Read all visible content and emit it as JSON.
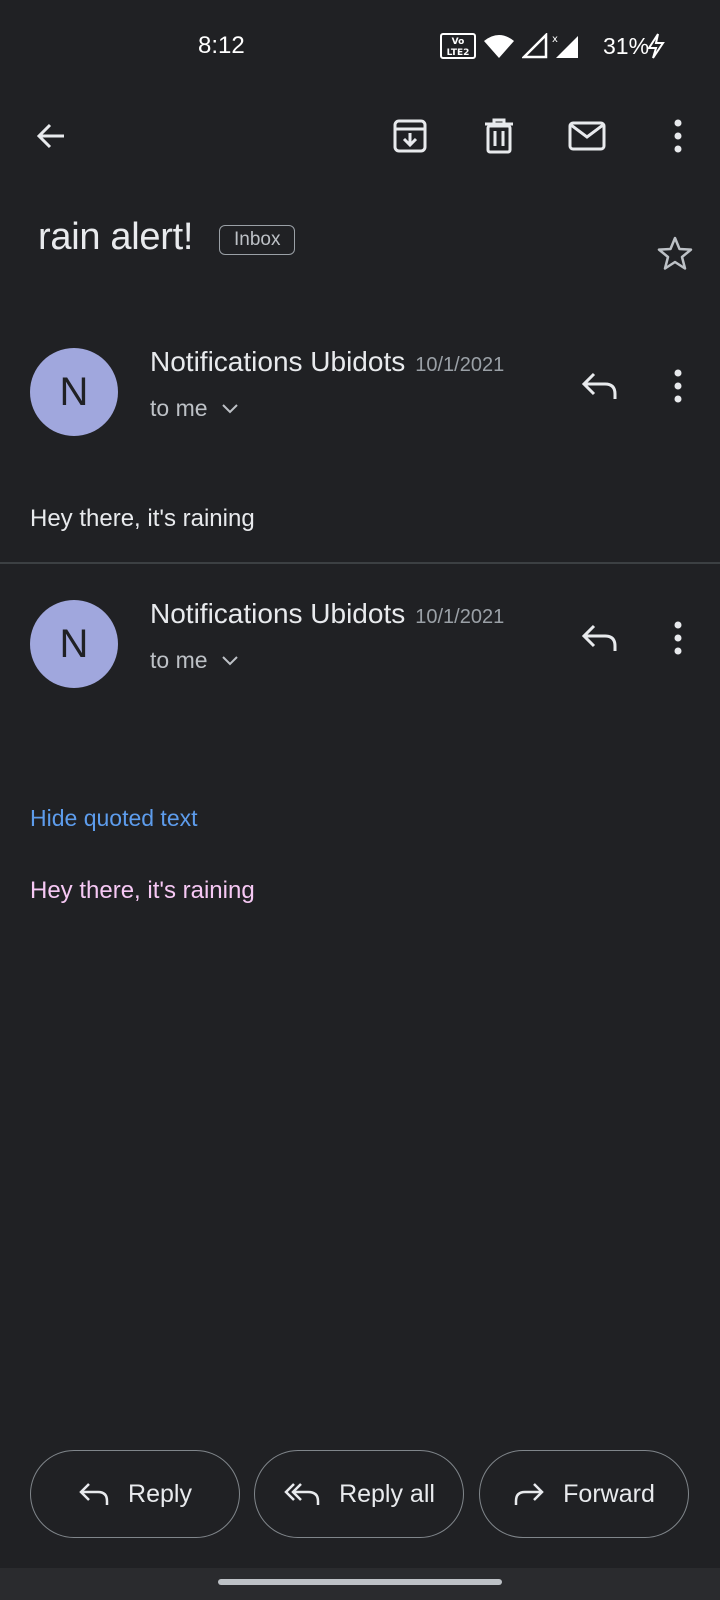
{
  "status_bar": {
    "time": "8:12",
    "volte_label": "Vo LTE 2",
    "battery": "31%"
  },
  "toolbar": {
    "icons": [
      "back-arrow-icon",
      "archive-icon",
      "delete-icon",
      "mark-unread-icon",
      "more-vert-icon"
    ]
  },
  "email": {
    "subject": "rain alert!",
    "label": "Inbox",
    "messages": [
      {
        "avatar_letter": "N",
        "sender": "Notifications Ubidots",
        "date": "10/1/2021",
        "recipient": "to me",
        "body": "Hey there, it's raining"
      },
      {
        "avatar_letter": "N",
        "sender": "Notifications Ubidots",
        "date": "10/1/2021",
        "recipient": "to me",
        "hide_quoted": "Hide quoted text",
        "quoted_body": "Hey there, it's raining"
      }
    ]
  },
  "actions": {
    "reply": "Reply",
    "reply_all": "Reply all",
    "forward": "Forward"
  },
  "colors": {
    "background": "#202124",
    "avatar": "#a0a7dd",
    "link": "#5d9cec",
    "quoted_text": "#f6c8f4"
  }
}
